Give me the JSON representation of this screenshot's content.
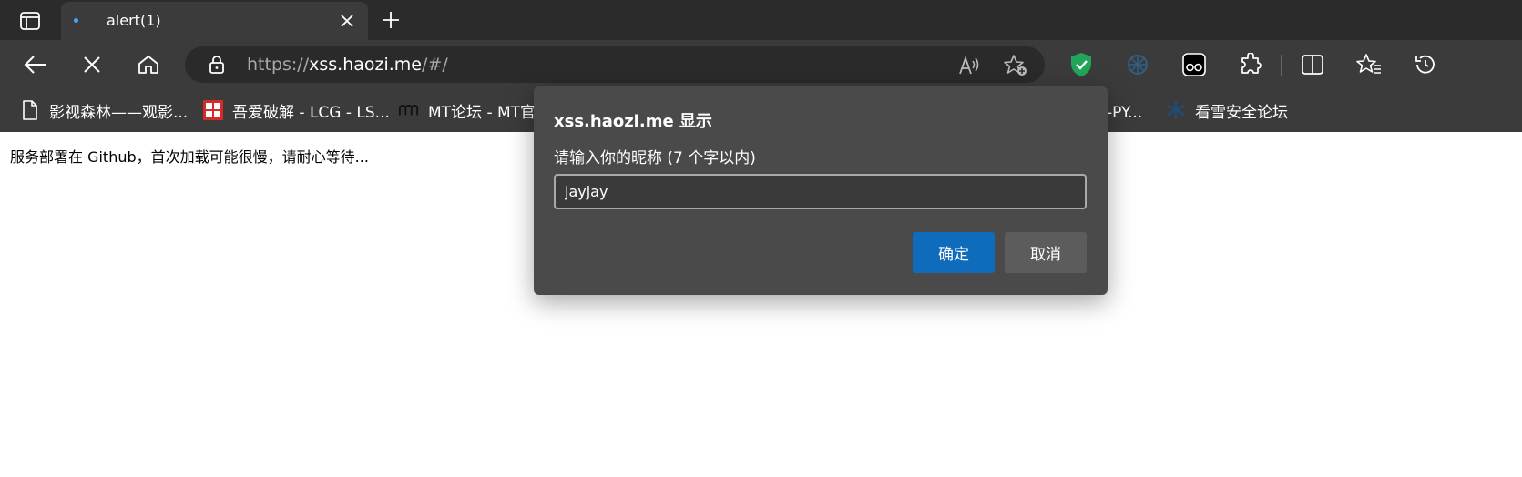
{
  "tab": {
    "title": "alert(1)"
  },
  "address": {
    "scheme": "https://",
    "host": "xss.haozi.me",
    "path": "/#/"
  },
  "bookmarks": [
    {
      "label": "影视森林——观影..."
    },
    {
      "label": "吾爱破解 - LCG - LS..."
    },
    {
      "label": "MT论坛 - MT官"
    },
    {
      "label": "云-PY..."
    },
    {
      "label": "看雪安全论坛"
    }
  ],
  "page": {
    "message": "服务部署在 Github，首次加载可能很慢，请耐心等待..."
  },
  "dialog": {
    "title": "xss.haozi.me 显示",
    "prompt": "请输入你的昵称 (7 个字以内)",
    "input_value": "jayjay",
    "ok_label": "确定",
    "cancel_label": "取消"
  },
  "colors": {
    "accent": "#0f6cbd",
    "shield": "#22a55a"
  }
}
